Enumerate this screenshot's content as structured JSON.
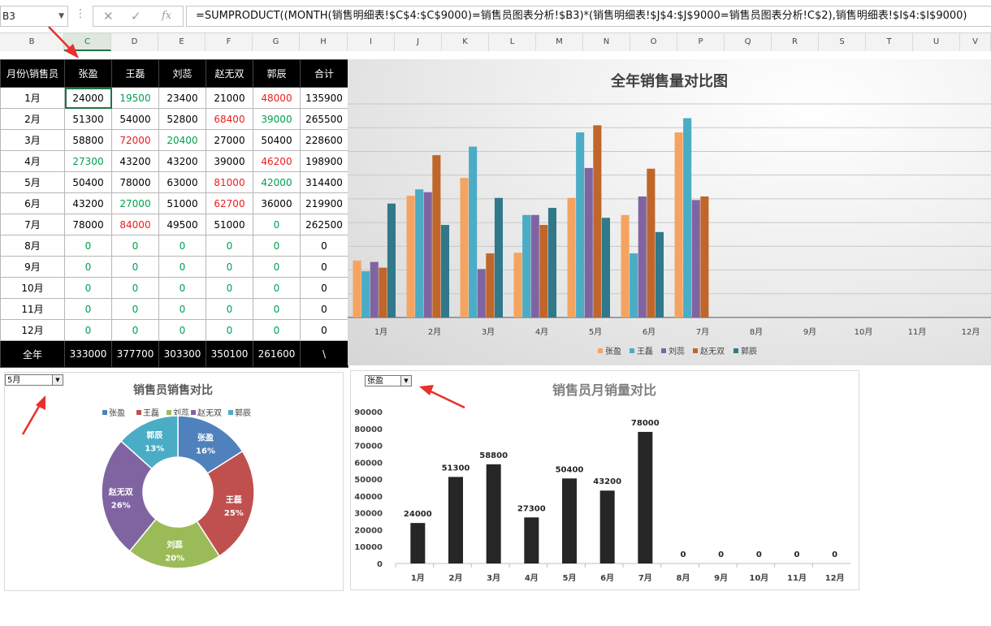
{
  "formula_bar": {
    "name_box": "B3",
    "formula": "=SUMPRODUCT((MONTH(销售明细表!$C$4:$C$9000)=销售员图表分析!$B3)*(销售明细表!$J$4:$J$9000=销售员图表分析!C$2),销售明细表!$I$4:$I$9000)",
    "icon_cancel": "cancel-icon",
    "icon_enter": "check-icon",
    "icon_fx": "function-icon"
  },
  "columns": [
    "B",
    "C",
    "D",
    "E",
    "F",
    "G",
    "H",
    "I",
    "J",
    "K",
    "L",
    "M",
    "N",
    "O",
    "P",
    "Q",
    "R",
    "S",
    "T",
    "U",
    "V"
  ],
  "table": {
    "corner": "月份\\销售员",
    "sellers": [
      "张盈",
      "王磊",
      "刘蕊",
      "赵无双",
      "郭辰"
    ],
    "total_label": "合计",
    "rows": [
      {
        "month": "1月",
        "vals": [
          24000,
          19500,
          23400,
          21000,
          48000
        ],
        "total": 135900
      },
      {
        "month": "2月",
        "vals": [
          51300,
          54000,
          52800,
          68400,
          39000
        ],
        "total": 265500
      },
      {
        "month": "3月",
        "vals": [
          58800,
          72000,
          20400,
          27000,
          50400
        ],
        "total": 228600
      },
      {
        "month": "4月",
        "vals": [
          27300,
          43200,
          43200,
          39000,
          46200
        ],
        "total": 198900
      },
      {
        "month": "5月",
        "vals": [
          50400,
          78000,
          63000,
          81000,
          42000
        ],
        "total": 314400
      },
      {
        "month": "6月",
        "vals": [
          43200,
          27000,
          51000,
          62700,
          36000
        ],
        "total": 219900
      },
      {
        "month": "7月",
        "vals": [
          78000,
          84000,
          49500,
          51000,
          0
        ],
        "total": 262500
      },
      {
        "month": "8月",
        "vals": [
          0,
          0,
          0,
          0,
          0
        ],
        "total": 0
      },
      {
        "month": "9月",
        "vals": [
          0,
          0,
          0,
          0,
          0
        ],
        "total": 0
      },
      {
        "month": "10月",
        "vals": [
          0,
          0,
          0,
          0,
          0
        ],
        "total": 0
      },
      {
        "month": "11月",
        "vals": [
          0,
          0,
          0,
          0,
          0
        ],
        "total": 0
      },
      {
        "month": "12月",
        "vals": [
          0,
          0,
          0,
          0,
          0
        ],
        "total": 0
      }
    ],
    "year_row": {
      "label": "全年",
      "vals": [
        333000,
        377700,
        303300,
        350100,
        261600
      ],
      "total": "\\"
    }
  },
  "colors": {
    "min_value": "#00a050",
    "max_value": "#ee1c1c",
    "selection": "#217346",
    "arrow": "#e8302c"
  },
  "chart_data": [
    {
      "type": "bar",
      "title": "全年销售量对比图",
      "categories": [
        "1月",
        "2月",
        "3月",
        "4月",
        "5月",
        "6月",
        "7月",
        "8月",
        "9月",
        "10月",
        "11月",
        "12月"
      ],
      "series": [
        {
          "name": "张盈",
          "color": "#f4a460",
          "values": [
            24000,
            51300,
            58800,
            27300,
            50400,
            43200,
            78000,
            0,
            0,
            0,
            0,
            0
          ]
        },
        {
          "name": "王磊",
          "color": "#4bacc6",
          "values": [
            19500,
            54000,
            72000,
            43200,
            78000,
            27000,
            84000,
            0,
            0,
            0,
            0,
            0
          ]
        },
        {
          "name": "刘蕊",
          "color": "#8064a2",
          "values": [
            23400,
            52800,
            20400,
            43200,
            63000,
            51000,
            49500,
            0,
            0,
            0,
            0,
            0
          ]
        },
        {
          "name": "赵无双",
          "color": "#c0662a",
          "values": [
            21000,
            68400,
            27000,
            39000,
            81000,
            62700,
            51000,
            0,
            0,
            0,
            0,
            0
          ]
        },
        {
          "name": "郭辰",
          "color": "#31788a",
          "values": [
            48000,
            39000,
            50400,
            46200,
            42000,
            36000,
            0,
            0,
            0,
            0,
            0,
            0
          ]
        }
      ],
      "ylim": [
        0,
        90000
      ],
      "legend": "bottom",
      "grid": true
    },
    {
      "type": "pie",
      "title": "销售员销售对比",
      "selector_value": "5月",
      "labels": [
        "张盈",
        "王磊",
        "刘蕊",
        "赵无双",
        "郭辰"
      ],
      "values": [
        50400,
        78000,
        63000,
        81000,
        42000
      ],
      "percent_labels": [
        "16%",
        "25%",
        "20%",
        "26%",
        "13%"
      ],
      "colors": [
        "#4f81bd",
        "#c0504d",
        "#9bbb59",
        "#8064a2",
        "#4bacc6"
      ],
      "legend": "top"
    },
    {
      "type": "bar",
      "title": "销售员月销量对比",
      "selector_value": "张盈",
      "categories": [
        "1月",
        "2月",
        "3月",
        "4月",
        "5月",
        "6月",
        "7月",
        "8月",
        "9月",
        "10月",
        "11月",
        "12月"
      ],
      "values": [
        24000,
        51300,
        58800,
        27300,
        50400,
        43200,
        78000,
        0,
        0,
        0,
        0,
        0
      ],
      "yticks": [
        0,
        10000,
        20000,
        30000,
        40000,
        50000,
        60000,
        70000,
        80000,
        90000
      ],
      "ylim": [
        0,
        90000
      ],
      "color": "#262626",
      "grid": false
    }
  ]
}
